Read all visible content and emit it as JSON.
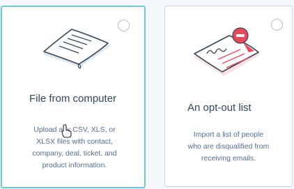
{
  "cards": [
    {
      "title": "File from computer",
      "description": [
        "Upload any CSV, XLS, or",
        "XLSX files with contact,",
        "company, deal, ticket, and",
        "product information."
      ],
      "selected": true,
      "icon": "document-icon"
    },
    {
      "title": "An opt-out list",
      "description": [
        "Import a list of people",
        "who are disqualified from",
        "receiving emails."
      ],
      "selected": false,
      "icon": "opt-out-document-icon"
    }
  ],
  "colors": {
    "selected_border": "#6fc8d4",
    "accent_red": "#e9485b",
    "text": "#33475b"
  }
}
